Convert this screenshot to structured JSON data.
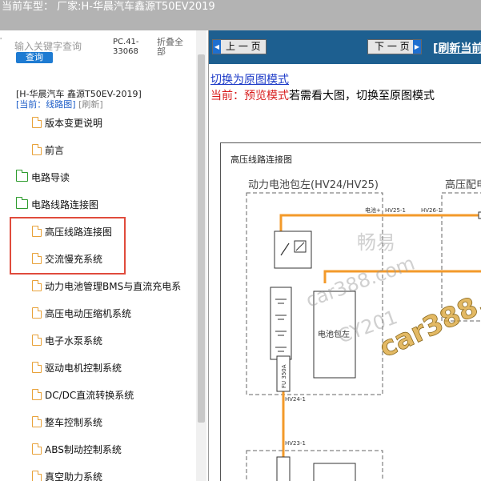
{
  "app": {
    "title": "当前车型： 厂家:H-华晨汽车鑫源T50EV2019"
  },
  "left": {
    "search_placeholder": "输入关键字查询",
    "search_button": "查询",
    "pc_code": "PC.41-33068",
    "collapse_all": "折叠全部",
    "car_model": "[H-华晨汽车 鑫源T50EV-2019]",
    "current_label": "[当前：线路图]",
    "refresh_label": "[刷新]",
    "tree": [
      {
        "label": "版本变更说明",
        "type": "leaf"
      },
      {
        "label": "前言",
        "type": "leaf"
      },
      {
        "label": "电路导读",
        "type": "folder"
      },
      {
        "label": "电路线路连接图",
        "type": "folder-open"
      },
      {
        "label": "高压线路连接图",
        "type": "leaf"
      },
      {
        "label": "交流慢充系统",
        "type": "leaf"
      },
      {
        "label": "动力电池管理BMS与直流充电系",
        "type": "leaf"
      },
      {
        "label": "高压电动压缩机系统",
        "type": "leaf"
      },
      {
        "label": "电子水泵系统",
        "type": "leaf"
      },
      {
        "label": "驱动电机控制系统",
        "type": "leaf"
      },
      {
        "label": "DC/DC直流转换系统",
        "type": "leaf"
      },
      {
        "label": "整车控制系统",
        "type": "leaf"
      },
      {
        "label": "ABS制动控制系统",
        "type": "leaf"
      },
      {
        "label": "真空助力系统",
        "type": "leaf"
      }
    ]
  },
  "right": {
    "prev_label": "上 一 页",
    "next_label": "下 一 页",
    "refresh_label": "[刷新当前",
    "switch_link": "切换为原图模式",
    "current_prefix": "当前：预览模式",
    "current_suffix": "若需看大图，切换至原图模式"
  },
  "diagram": {
    "title": "高压线路连接图",
    "battery_section": "动力电池包左(HV24/HV25)",
    "dist_section": "高压配电",
    "battery_label": "电池包左",
    "fuse_label": "FU 350A",
    "connectors": [
      "HV25-1",
      "HV26-1",
      "HV24-1",
      "HV23-1"
    ],
    "small_label": "电池+",
    "watermark": [
      "畅易",
      "car388.com",
      "CY201",
      "car388.c"
    ]
  },
  "colors": {
    "accent": "#1d5f90",
    "link": "#1f3cc8",
    "highlight": "#e04b3c",
    "wire": "#f39a2a"
  }
}
